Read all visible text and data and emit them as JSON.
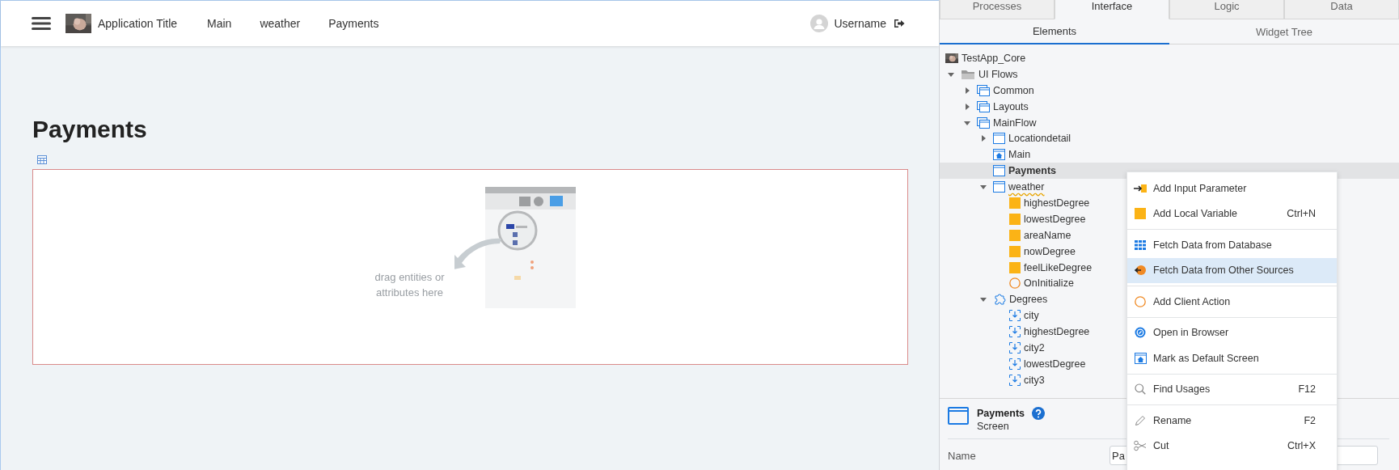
{
  "canvas": {
    "header": {
      "app_title": "Application Title",
      "nav": [
        {
          "label": "Main"
        },
        {
          "label": "weather"
        },
        {
          "label": "Payments"
        }
      ],
      "username": "Username"
    },
    "page_title": "Payments",
    "drop_area": {
      "hint": "drag entities or attributes here"
    }
  },
  "panel": {
    "tabs": [
      {
        "label": "Processes",
        "selected": false
      },
      {
        "label": "Interface",
        "selected": true
      },
      {
        "label": "Logic",
        "selected": false
      },
      {
        "label": "Data",
        "selected": false
      }
    ],
    "subtabs": [
      {
        "label": "Elements",
        "selected": true
      },
      {
        "label": "Widget Tree",
        "selected": false
      }
    ],
    "tree": [
      {
        "label": "TestApp_Core",
        "kind": "app",
        "selected": false,
        "warning": false
      },
      {
        "label": "UI Flows",
        "kind": "folder",
        "expanded": true,
        "selected": false,
        "warning": false,
        "children": [
          {
            "label": "Common",
            "kind": "flow",
            "expanded": false,
            "selected": false,
            "warning": false
          },
          {
            "label": "Layouts",
            "kind": "flow",
            "expanded": false,
            "selected": false,
            "warning": false
          },
          {
            "label": "MainFlow",
            "kind": "flow",
            "expanded": true,
            "selected": false,
            "warning": false,
            "children": [
              {
                "label": "Locationdetail",
                "kind": "screen",
                "expanded": false,
                "selected": false,
                "warning": false
              },
              {
                "label": "Main",
                "kind": "home-screen",
                "selected": false,
                "warning": false
              },
              {
                "label": "Payments",
                "kind": "screen",
                "selected": true,
                "warning": false
              },
              {
                "label": "weather",
                "kind": "screen",
                "expanded": true,
                "selected": false,
                "warning": true,
                "children": [
                  {
                    "label": "highestDegree",
                    "kind": "variable",
                    "selected": false,
                    "warning": false
                  },
                  {
                    "label": "lowestDegree",
                    "kind": "variable",
                    "selected": false,
                    "warning": false
                  },
                  {
                    "label": "areaName",
                    "kind": "variable",
                    "selected": false,
                    "warning": false
                  },
                  {
                    "label": "nowDegree",
                    "kind": "variable",
                    "selected": false,
                    "warning": false
                  },
                  {
                    "label": "feelLikeDegree",
                    "kind": "variable",
                    "selected": false,
                    "warning": false
                  },
                  {
                    "label": "OnInitialize",
                    "kind": "action",
                    "selected": false,
                    "warning": false
                  }
                ]
              },
              {
                "label": "Degrees",
                "kind": "block",
                "expanded": true,
                "selected": false,
                "warning": false,
                "children": [
                  {
                    "label": "city",
                    "kind": "input",
                    "selected": false,
                    "warning": false
                  },
                  {
                    "label": "highestDegree",
                    "kind": "input",
                    "selected": false,
                    "warning": false
                  },
                  {
                    "label": "city2",
                    "kind": "input",
                    "selected": false,
                    "warning": false
                  },
                  {
                    "label": "lowestDegree",
                    "kind": "input",
                    "selected": false,
                    "warning": false
                  },
                  {
                    "label": "city3",
                    "kind": "input",
                    "selected": false,
                    "warning": false
                  }
                ]
              }
            ]
          }
        ]
      }
    ],
    "properties": {
      "title": "Payments",
      "type": "Screen",
      "fields": [
        {
          "label": "Name",
          "value": "Pa"
        }
      ]
    }
  },
  "context_menu": {
    "groups": [
      [
        {
          "label": "Add Input Parameter",
          "kind": "input-param",
          "highlighted": false
        },
        {
          "label": "Add Local Variable",
          "kind": "variable",
          "shortcut": "Ctrl+N",
          "highlighted": false
        }
      ],
      [
        {
          "label": "Fetch Data from Database",
          "kind": "aggregate",
          "highlighted": false
        },
        {
          "label": "Fetch Data from Other Sources",
          "kind": "data-action",
          "highlighted": true
        }
      ],
      [
        {
          "label": "Add Client Action",
          "kind": "client-action",
          "highlighted": false
        }
      ],
      [
        {
          "label": "Open in Browser",
          "kind": "browser",
          "highlighted": false
        },
        {
          "label": "Mark as Default Screen",
          "kind": "default-screen",
          "highlighted": false
        }
      ],
      [
        {
          "label": "Find Usages",
          "kind": "search",
          "shortcut": "F12",
          "highlighted": false
        }
      ],
      [
        {
          "label": "Rename",
          "kind": "rename",
          "shortcut": "F2",
          "highlighted": false
        },
        {
          "label": "Cut",
          "kind": "cut",
          "shortcut": "Ctrl+X",
          "highlighted": false
        }
      ]
    ]
  }
}
